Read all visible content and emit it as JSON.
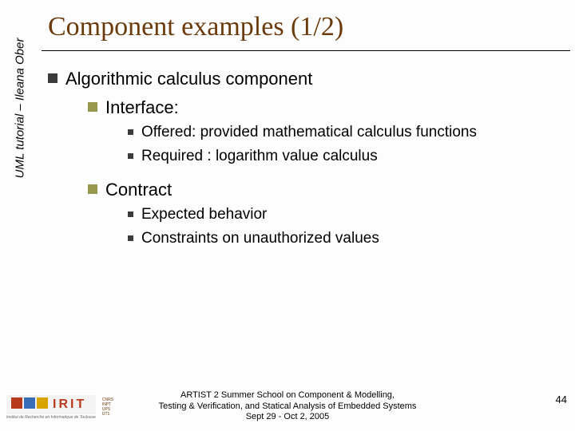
{
  "side_label": "UML tutorial – Ileana Ober",
  "title": "Component examples (1/2)",
  "bullets": {
    "l1": "Algorithmic calculus component",
    "l2a": "Interface:",
    "l3a1": "Offered: provided mathematical calculus functions",
    "l3a2": "Required : logarithm value calculus",
    "l2b": "Contract",
    "l3b1": "Expected behavior",
    "l3b2": "Constraints on unauthorized values"
  },
  "logo": {
    "name": "IRIT",
    "subtitle": "Institut de Recherche en Informatique de Toulouse",
    "mini": [
      "CNRS",
      "INPT",
      "UPS",
      "UT1"
    ]
  },
  "footer": {
    "line1": "ARTIST 2 Summer School on Component & Modelling,",
    "line2": "Testing & Verification, and Statical Analysis of Embedded Systems",
    "line3": "Sept 29 - Oct 2, 2005"
  },
  "page_number": "44"
}
